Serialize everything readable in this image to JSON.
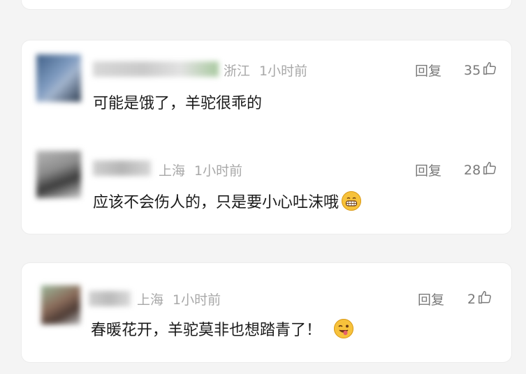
{
  "comments": [
    {
      "location": "浙江",
      "time": "1小时前",
      "reply_label": "回复",
      "likes": "35",
      "text": "可能是饿了，羊驼很乖的",
      "emoji": ""
    },
    {
      "location": "上海",
      "time": "1小时前",
      "reply_label": "回复",
      "likes": "28",
      "text": "应该不会伤人的，只是要小心吐沫哦",
      "emoji": "grinning-face-emoji"
    },
    {
      "location": "上海",
      "time": "1小时前",
      "reply_label": "回复",
      "likes": "2",
      "text": "春暖花开，羊驼莫非也想踏青了！",
      "emoji": "winking-tongue-face-emoji"
    }
  ],
  "icons": {
    "like": "thumbs-up-outline-icon"
  },
  "colors": {
    "background": "#f4f4f4",
    "card": "#ffffff",
    "meta_text": "#a8a8a8",
    "action_text": "#7a7a7a",
    "body_text": "#1b1b1b"
  }
}
